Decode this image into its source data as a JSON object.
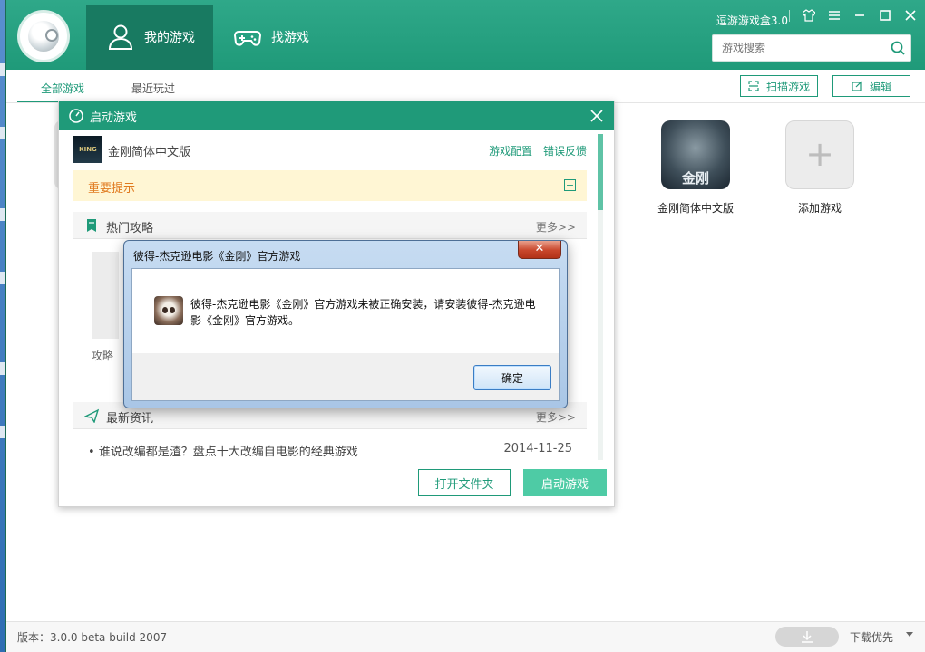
{
  "app": {
    "title": "逗游游戏盒3.0",
    "nav": [
      {
        "label": "我的游戏",
        "icon": "user-icon",
        "active": true
      },
      {
        "label": "找游戏",
        "icon": "gamepad-icon",
        "active": false
      }
    ],
    "search": {
      "placeholder": "游戏搜索"
    },
    "window_controls": [
      "skin-icon",
      "menu-icon",
      "minimize-icon",
      "maximize-icon",
      "close-icon"
    ]
  },
  "subtabs": [
    {
      "label": "全部游戏",
      "active": true
    },
    {
      "label": "最近玩过",
      "active": false
    }
  ],
  "toolbar": {
    "scan_label": "扫描游戏",
    "edit_label": "编辑"
  },
  "games": [
    {
      "name": "金刚简体中文版"
    },
    {
      "name": "添加游戏"
    }
  ],
  "status": {
    "version": "版本：3.0.0 beta build 2007",
    "download": "下载优先"
  },
  "launch_dialog": {
    "title": "启动游戏",
    "game_name": "金刚简体中文版",
    "game_thumb_text": "KING KONG",
    "config_link": "游戏配置",
    "feedback_link": "错误反馈",
    "notice": "重要提示",
    "hot_guides": {
      "title": "热门攻略",
      "more": "更多>>",
      "item_label": "攻略"
    },
    "news": {
      "title": "最新资讯",
      "more": "更多>>",
      "item": {
        "title": "• 谁说改编都是渣？盘点十大改编自电影的经典游戏",
        "date": "2014-11-25"
      }
    },
    "open_folder": "打开文件夹",
    "launch": "启动游戏"
  },
  "message_box": {
    "title": "彼得-杰克逊电影《金刚》官方游戏",
    "text": "彼得-杰克逊电影《金刚》官方游戏未被正确安装，请安装彼得-杰克逊电影《金刚》官方游戏。",
    "ok": "确定"
  },
  "colors": {
    "brand": "#1f9a79",
    "brand_dark": "#187a61",
    "notice_bg": "#fff6d4",
    "notice_text": "#e07a1f",
    "launch_button": "#4ecba5"
  }
}
